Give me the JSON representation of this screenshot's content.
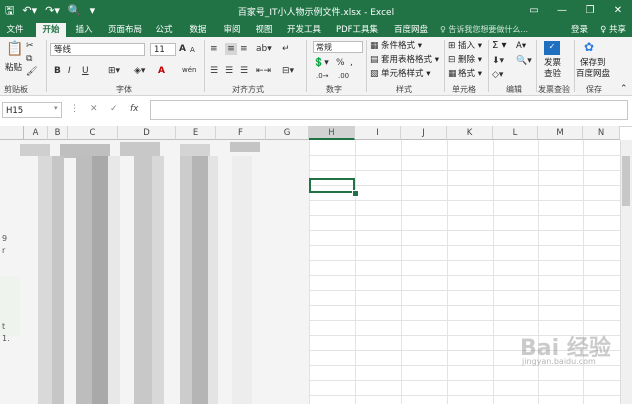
{
  "app": {
    "title": "百家号_IT小人物示例文件.xlsx - Excel",
    "quick_access": [
      "save-icon",
      "undo-icon",
      "redo-icon",
      "print-preview-icon",
      "customize-icon"
    ],
    "window_controls": [
      "ribbon-display-icon",
      "minimize-icon",
      "restore-icon",
      "close-icon"
    ]
  },
  "tabs": [
    "文件",
    "开始",
    "插入",
    "页面布局",
    "公式",
    "数据",
    "审阅",
    "视图",
    "开发工具",
    "PDF工具集",
    "百度网盘"
  ],
  "active_tab": "开始",
  "tell_me": "♀ 告诉我您想要做什么...",
  "account": {
    "login": "登录",
    "share": "♀ 共享"
  },
  "ribbon": {
    "clipboard": {
      "paste": "粘贴",
      "label": "剪贴板"
    },
    "font": {
      "name": "等线",
      "size": "11",
      "label": "字体",
      "bold": "B",
      "italic": "I",
      "underline": "U",
      "inc": "A",
      "dec": "A",
      "wen": "wén",
      "color_letter": "A"
    },
    "alignment": {
      "label": "对齐方式"
    },
    "number": {
      "format": "常规",
      "percent": "%",
      "comma": ",",
      "label": "数字"
    },
    "styles": {
      "conditional": "条件格式 ▾",
      "table": "套用表格格式 ▾",
      "cell": "单元格样式 ▾",
      "label": "样式"
    },
    "cells": {
      "insert": "插入 ▾",
      "delete": "删除 ▾",
      "format": "格式 ▾",
      "label": "单元格"
    },
    "editing": {
      "label": "编辑",
      "sum": "Σ ▾",
      "sort": "A▾"
    },
    "invoice": {
      "btn_line1": "发票",
      "btn_line2": "查验",
      "label": "发票查验"
    },
    "save": {
      "btn_line1": "保存到",
      "btn_line2": "百度网盘",
      "label": "保存"
    }
  },
  "formula_bar": {
    "name_box": "H15",
    "cancel": "✕",
    "enter": "✓",
    "fx": "fx",
    "value": ""
  },
  "columns": [
    "A",
    "B",
    "C",
    "D",
    "E",
    "F",
    "G",
    "H",
    "I",
    "J",
    "K",
    "L",
    "M",
    "N"
  ],
  "selected_column": "H",
  "selected_cell": "H15",
  "row_glyphs": [
    "9",
    "r",
    "t",
    "1."
  ],
  "watermark": {
    "main": "Bai 经验",
    "sub": "jingyan.baidu.com"
  },
  "colors": {
    "accent": "#217346",
    "ribbon_bg": "#f3f3f3",
    "grid_line": "#e3e3e3"
  }
}
